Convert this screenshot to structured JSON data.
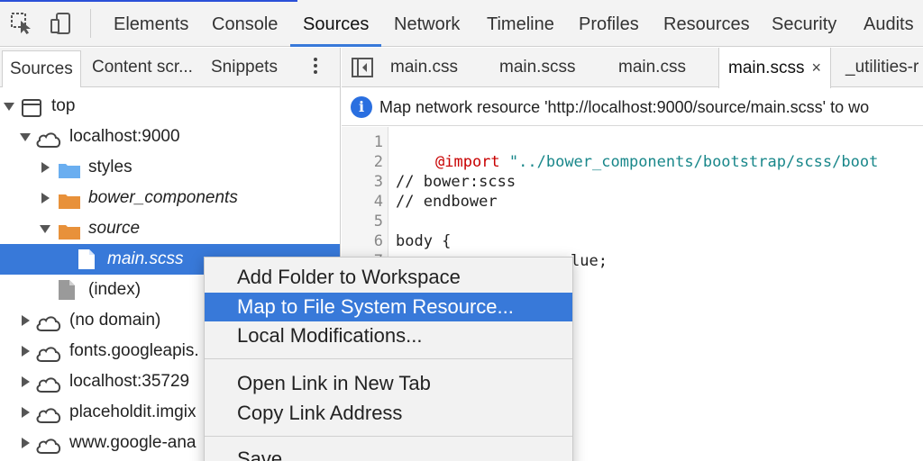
{
  "toolbar": {
    "main_tabs": [
      {
        "label": "Elements"
      },
      {
        "label": "Console"
      },
      {
        "label": "Sources"
      },
      {
        "label": "Network"
      },
      {
        "label": "Timeline"
      },
      {
        "label": "Profiles"
      },
      {
        "label": "Resources"
      },
      {
        "label": "Security"
      },
      {
        "label": "Audits"
      }
    ],
    "active_tab": "Sources",
    "accent_color": "#3879d9"
  },
  "navigator": {
    "tabs": [
      {
        "label": "Sources"
      },
      {
        "label": "Content scr..."
      },
      {
        "label": "Snippets"
      }
    ],
    "tree": [
      {
        "label": "top",
        "icon": "frame-icon"
      },
      {
        "label": "localhost:9000",
        "icon": "cloud-icon"
      },
      {
        "label": "styles",
        "icon": "folder-icon"
      },
      {
        "label": "bower_components",
        "icon": "folder-icon"
      },
      {
        "label": "source",
        "icon": "folder-icon"
      },
      {
        "label": "main.scss",
        "icon": "file-icon"
      },
      {
        "label": "(index)",
        "icon": "file-icon"
      },
      {
        "label": "(no domain)",
        "icon": "cloud-icon"
      },
      {
        "label": "fonts.googleapis.",
        "icon": "cloud-icon"
      },
      {
        "label": "localhost:35729",
        "icon": "cloud-icon"
      },
      {
        "label": "placeholdit.imgix",
        "icon": "cloud-icon"
      },
      {
        "label": "www.google-ana",
        "icon": "cloud-icon"
      }
    ]
  },
  "editor": {
    "tabs": [
      {
        "label": "main.css"
      },
      {
        "label": "main.scss"
      },
      {
        "label": "main.css"
      },
      {
        "label": "main.scss",
        "close": "×"
      },
      {
        "label": "_utilities-r"
      }
    ],
    "info_message": "Map network resource 'http://localhost:9000/source/main.scss' to wo",
    "code_lines": [
      {
        "num": "1"
      },
      {
        "num": "2",
        "at": "@import",
        "str": "\"../bower_components/bootstrap/scss/boot"
      },
      {
        "num": "3",
        "comment": "// bower:scss"
      },
      {
        "num": "4",
        "comment": "// endbower"
      },
      {
        "num": "5"
      },
      {
        "num": "6",
        "text": "body {"
      },
      {
        "num": "7",
        "val": "lue;"
      }
    ]
  },
  "context_menu": {
    "items": [
      {
        "label": "Add Folder to Workspace"
      },
      {
        "label": "Map to File System Resource..."
      },
      {
        "label": "Local Modifications..."
      },
      {
        "label": "Open Link in New Tab"
      },
      {
        "label": "Copy Link Address"
      },
      {
        "label": "Save"
      }
    ],
    "highlighted": "Map to File System Resource..."
  }
}
